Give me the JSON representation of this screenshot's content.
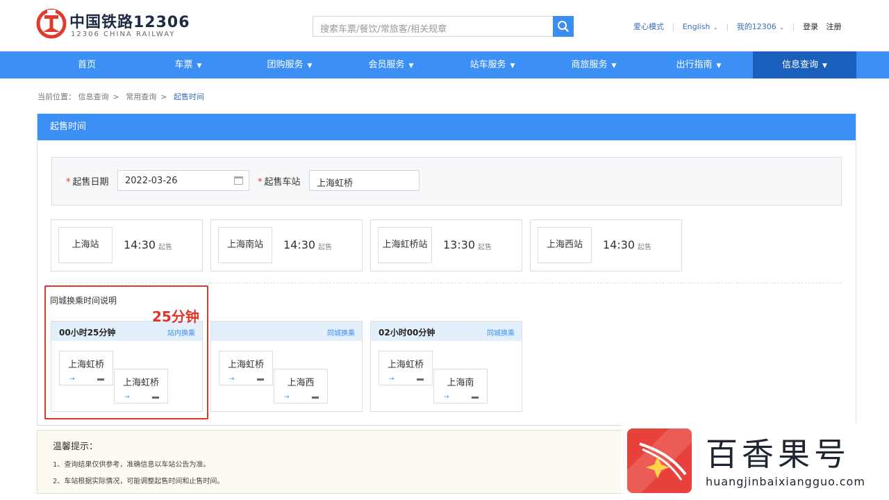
{
  "header": {
    "brand_cn": "中国铁路12306",
    "brand_en": "12306 CHINA RAILWAY",
    "search_placeholder": "搜索车票/餐饮/常旅客/相关规章",
    "links": {
      "care_mode": "爱心模式",
      "english": "English",
      "my12306": "我的12306",
      "login": "登录",
      "register": "注册"
    }
  },
  "nav": {
    "items": [
      {
        "label": "首页",
        "dropdown": false
      },
      {
        "label": "车票",
        "dropdown": true
      },
      {
        "label": "团购服务",
        "dropdown": true
      },
      {
        "label": "会员服务",
        "dropdown": true
      },
      {
        "label": "站车服务",
        "dropdown": true
      },
      {
        "label": "商旅服务",
        "dropdown": true
      },
      {
        "label": "出行指南",
        "dropdown": true
      },
      {
        "label": "信息查询",
        "dropdown": true,
        "active": true
      }
    ]
  },
  "breadcrumb": {
    "prefix": "当前位置：",
    "items": [
      "信息查询",
      "常用查询",
      "起售时间"
    ]
  },
  "panel": {
    "title": "起售时间",
    "form": {
      "date_label": "起售日期",
      "date_value": "2022-03-26",
      "station_label": "起售车站",
      "station_value": "上海虹桥"
    },
    "stations": [
      {
        "name": "上海站",
        "time": "14:30",
        "sale": "起售"
      },
      {
        "name": "上海南站",
        "time": "14:30",
        "sale": "起售"
      },
      {
        "name": "上海虹桥站",
        "time": "13:30",
        "sale": "起售"
      },
      {
        "name": "上海西站",
        "time": "14:30",
        "sale": "起售"
      }
    ],
    "transfer_title": "同城换乘时间说明",
    "transfers": [
      {
        "duration": "00小时25分钟",
        "type": "站内换乘",
        "from": "上海虹桥",
        "to": "上海虹桥"
      },
      {
        "duration": "",
        "type": "同城换乘",
        "from": "上海虹桥",
        "to": "上海西"
      },
      {
        "duration": "02小时00分钟",
        "type": "同城换乘",
        "from": "上海虹桥",
        "to": "上海南"
      }
    ],
    "annotation": "25分钟"
  },
  "tips": {
    "title": "温馨提示：",
    "lines": [
      "1、查询结果仅供参考，准确信息以车站公告为准。",
      "2、车站根据实际情况，可能调整起售时间和止售时间。"
    ]
  },
  "watermark": {
    "title": "百香果号",
    "url": "huangjinbaixiangguo.com"
  },
  "colors": {
    "nav_blue": "#3c8ff5",
    "nav_active": "#1b5fbd",
    "annotation_red": "#e1342a",
    "brand_red": "#e03a2f"
  }
}
